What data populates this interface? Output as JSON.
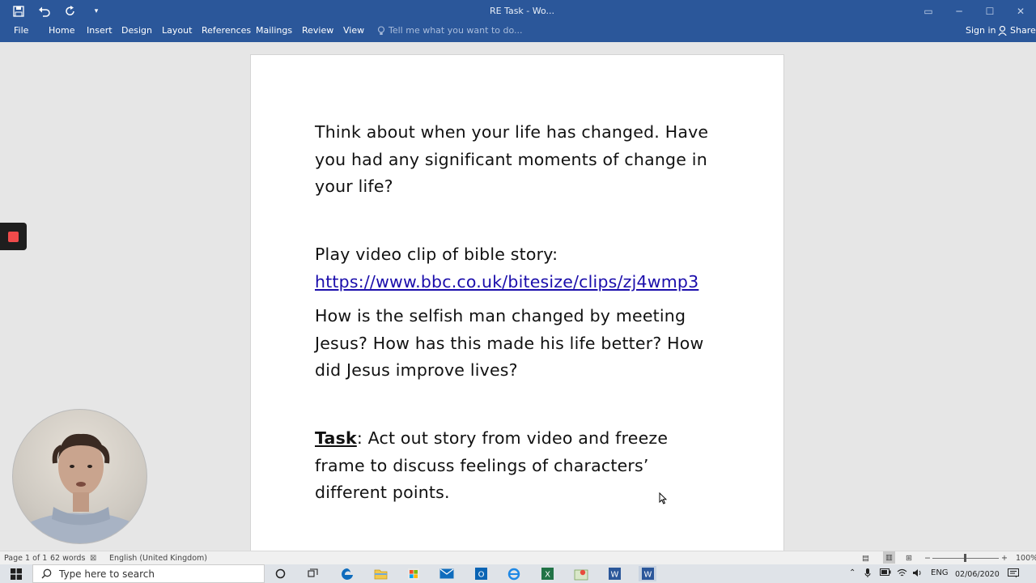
{
  "titlebar": {
    "title": "RE Task - Wo...",
    "qat": [
      {
        "name": "save-icon",
        "glyph": "💾"
      },
      {
        "name": "undo-icon",
        "glyph": "↶"
      },
      {
        "name": "redo-icon",
        "glyph": "↻"
      },
      {
        "name": "customize-qat-icon",
        "glyph": "▾"
      }
    ]
  },
  "ribbon": {
    "tabs": [
      "File",
      "Home",
      "Insert",
      "Design",
      "Layout",
      "References",
      "Mailings",
      "Review",
      "View"
    ],
    "tell_me_placeholder": "Tell me what you want to do...",
    "sign_in": "Sign in",
    "share": "Share"
  },
  "document": {
    "p1": "Think about when your life has changed. Have you had any significant moments of change in your life?",
    "p2": "Play video clip of bible story:",
    "link": "https://www.bbc.co.uk/bitesize/clips/zj4wmp3",
    "p4": "How is the selfish man changed by meeting Jesus? How has this made his life better? How did Jesus improve lives?",
    "task_label": "Task",
    "task_text": ": Act out story from video and freeze frame to discuss feelings of characters’ different points."
  },
  "statusbar": {
    "page": "Page 1 of 1",
    "words": "62 words",
    "language": "English (United Kingdom)",
    "zoom_minus": "−",
    "zoom_plus": "+",
    "zoom_value": "100%"
  },
  "taskbar": {
    "search_placeholder": "Type here to search",
    "language": "ENG",
    "date": "02/06/2020"
  }
}
